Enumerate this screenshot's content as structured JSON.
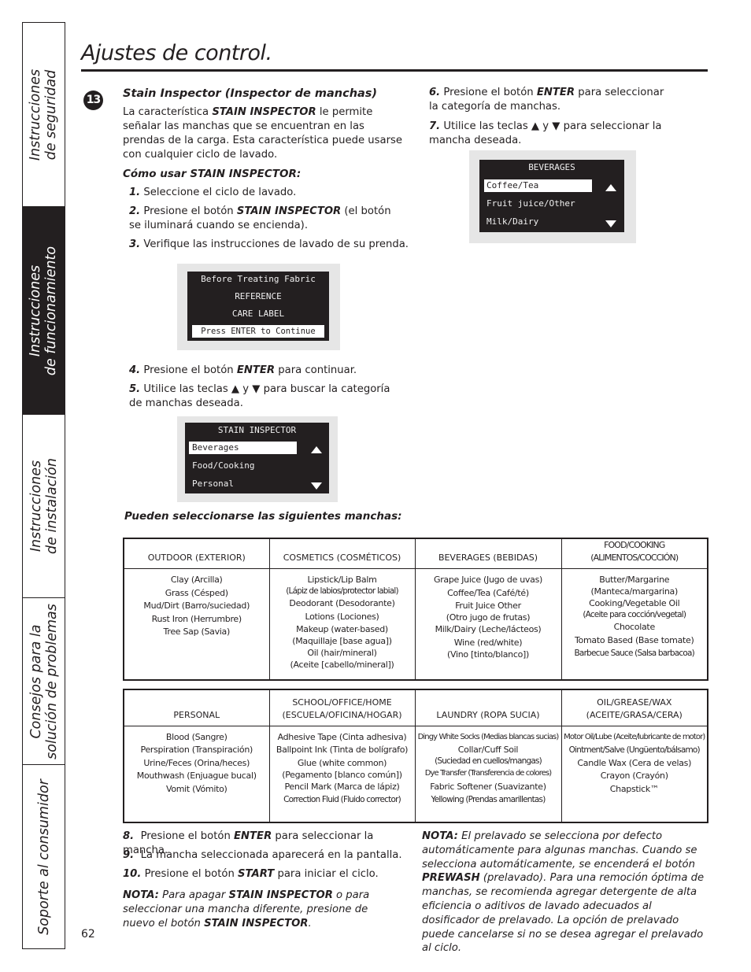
{
  "sidebar": {
    "tabs": [
      {
        "line1": "Instrucciones",
        "line2": "de seguridad",
        "active": false
      },
      {
        "line1": "Instrucciones",
        "line2": "de funcionamiento",
        "active": true
      },
      {
        "line1": "Instrucciones",
        "line2": "de instalación",
        "active": false
      },
      {
        "line1": "Consejos para la",
        "line2": "solución de problemas",
        "active": false
      },
      {
        "line1": "Soporte al consumidor",
        "line2": "",
        "active": false
      }
    ]
  },
  "header": {
    "title": "Ajustes de control."
  },
  "section": {
    "step_number": "13",
    "heading": "Stain Inspector (Inspector de manchas)",
    "intro": {
      "pre": "La característica ",
      "bold": "STAIN INSPECTOR",
      "post": " le permite señalar las manchas que se encuentran en las prendas de la carga. Esta característica puede usarse con cualquier ciclo de lavado."
    },
    "how_to_heading": "Cómo usar STAIN INSPECTOR:",
    "steps": [
      {
        "n": "1.",
        "pre": "Seleccione el ciclo de lavado.",
        "bold": "",
        "post": ""
      },
      {
        "n": "2.",
        "pre": "Presione el botón ",
        "bold": "STAIN INSPECTOR",
        "post": " (el botón se iluminará cuando se encienda)."
      },
      {
        "n": "3.",
        "pre": "Verifique las instrucciones de lavado de su prenda.",
        "bold": "",
        "post": ""
      },
      {
        "n": "4.",
        "pre": "Presione el botón ",
        "bold": "ENTER",
        "post": " para continuar."
      },
      {
        "n": "5.",
        "pre": "Utilice las teclas ▲ y ▼ para buscar la categoría de manchas deseada.",
        "bold": "",
        "post": ""
      },
      {
        "n": "6.",
        "pre": "Presione el botón ",
        "bold": "ENTER",
        "post": " para seleccionar la categoría de manchas."
      },
      {
        "n": "7.",
        "pre": "Utilice las teclas ▲ y ▼ para seleccionar la mancha deseada.",
        "bold": "",
        "post": ""
      },
      {
        "n": "8.",
        "pre": "Presione el botón ",
        "bold": "ENTER",
        "post": " para seleccionar la mancha."
      },
      {
        "n": "9.",
        "pre": "La mancha seleccionada aparecerá en la pantalla.",
        "bold": "",
        "post": ""
      },
      {
        "n": "10.",
        "pre": "Presione el botón ",
        "bold": "START",
        "post": " para iniciar el ciclo."
      }
    ]
  },
  "displays": {
    "care_label": {
      "lines": [
        "Before Treating Fabric",
        "REFERENCE",
        "CARE LABEL",
        "Press ENTER to Continue"
      ],
      "highlighted_index": 3
    },
    "stain_inspector": {
      "title": "STAIN INSPECTOR",
      "items": [
        "Beverages",
        "Food/Cooking",
        "Personal"
      ],
      "selected_index": 0,
      "up_icon": "up-triangle-icon",
      "down_icon": "down-triangle-icon"
    },
    "beverages": {
      "title": "BEVERAGES",
      "items": [
        "Coffee/Tea",
        "Fruit juice/Other",
        "Milk/Dairy"
      ],
      "selected_index": 0,
      "up_icon": "up-triangle-icon",
      "down_icon": "down-triangle-icon"
    }
  },
  "stains_heading": "Pueden seleccionarse las siguientes manchas:",
  "table1": {
    "headers": [
      "OUTDOOR (EXTERIOR)",
      "COSMETICS (COSMÉTICOS)",
      "BEVERAGES (BEBIDAS)",
      "FOOD/COOKING (ALIMENTOS/COCCIÓN)"
    ],
    "columns": [
      [
        "Clay (Arcilla)",
        "Grass (Césped)",
        "Mud/Dirt (Barro/suciedad)",
        "Rust Iron (Herrumbre)",
        "Tree Sap (Savia)"
      ],
      [
        "Lipstick/Lip Balm",
        "(Lápiz de labios/protector labial)",
        "Deodorant (Desodorante)",
        "Lotions (Lociones)",
        "Makeup (water-based)",
        "(Maquillaje [base agua])",
        "Oil (hair/mineral)",
        "(Aceite [cabello/mineral])"
      ],
      [
        "Grape Juice (Jugo de uvas)",
        "Coffee/Tea (Café/té)",
        "Fruit Juice Other",
        "(Otro jugo de frutas)",
        "Milk/Dairy (Leche/lácteos)",
        "Wine (red/white)",
        "(Vino [tinto/blanco])"
      ],
      [
        "Butter/Margarine",
        "(Manteca/margarina)",
        "Cooking/Vegetable Oil",
        "(Aceite para cocción/vegetal)",
        "Chocolate",
        "Tomato Based (Base tomate)",
        "Barbecue Sauce (Salsa barbacoa)"
      ]
    ]
  },
  "table2": {
    "headers": [
      [
        "PERSONAL",
        ""
      ],
      [
        "SCHOOL/OFFICE/HOME",
        "(ESCUELA/OFICINA/HOGAR)"
      ],
      [
        "LAUNDRY (ROPA SUCIA)",
        ""
      ],
      [
        "OIL/GREASE/WAX",
        "(ACEITE/GRASA/CERA)"
      ]
    ],
    "columns": [
      [
        "Blood (Sangre)",
        "Perspiration (Transpiración)",
        "Urine/Feces (Orina/heces)",
        "Mouthwash (Enjuague bucal)",
        "Vomit (Vómito)"
      ],
      [
        "Adhesive Tape (Cinta adhesiva)",
        "Ballpoint Ink (Tinta de bolígrafo)",
        "Glue (white common)",
        "(Pegamento [blanco común])",
        "Pencil Mark (Marca de lápiz)",
        "Correction Fluid (Fluido corrector)"
      ],
      [
        "Dingy White Socks (Medias blancas sucias)",
        "Collar/Cuff Soil",
        "(Suciedad en cuellos/mangas)",
        "Dye Transfer (Transferencia de colores)",
        "Fabric Softener (Suavizante)",
        "Yellowing (Prendas amarillentas)"
      ],
      [
        "Motor Oil/Lube (Aceite/lubricante de motor)",
        "Ointment/Salve (Ungüento/bálsamo)",
        "Candle Wax (Cera de velas)",
        "Crayon (Crayón)",
        "Chapstick™"
      ]
    ]
  },
  "note_left": {
    "label": "NOTA:",
    "p1": " Para apagar ",
    "b1": "STAIN INSPECTOR",
    "p2": " o para seleccionar una mancha diferente, presione de nuevo el botón ",
    "b2": "STAIN INSPECTOR",
    "p3": "."
  },
  "note_right": {
    "label": "NOTA:",
    "p1": " El prelavado se selecciona por defecto automáticamente para algunas manchas. Cuando se selecciona automáticamente, se encenderá el botón ",
    "b1": "PREWASH",
    "p2": " (prelavado). Para una remoción óptima de manchas, se recomienda agregar detergente de alta eficiencia o aditivos de lavado adecuados al dosificador de prelavado. La opción de prelavado puede cancelarse si no se desea agregar el prelavado al ciclo."
  },
  "footer": {
    "page_number": "62"
  }
}
